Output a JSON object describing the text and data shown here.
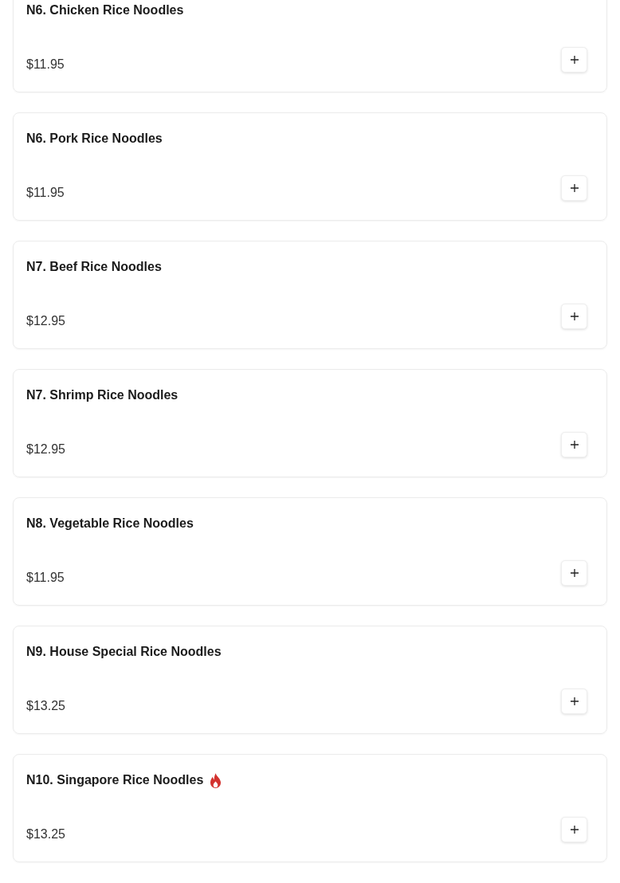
{
  "menu_items": [
    {
      "name": "N6. Chicken Rice Noodles",
      "price": "$11.95",
      "spicy": false
    },
    {
      "name": "N6. Pork Rice Noodles",
      "price": "$11.95",
      "spicy": false
    },
    {
      "name": "N7. Beef Rice Noodles",
      "price": "$12.95",
      "spicy": false
    },
    {
      "name": "N7. Shrimp Rice Noodles",
      "price": "$12.95",
      "spicy": false
    },
    {
      "name": "N8. Vegetable Rice Noodles",
      "price": "$11.95",
      "spicy": false
    },
    {
      "name": "N9. House Special Rice Noodles",
      "price": "$13.25",
      "spicy": false
    },
    {
      "name": "N10. Singapore Rice Noodles",
      "price": "$13.25",
      "spicy": true
    }
  ]
}
